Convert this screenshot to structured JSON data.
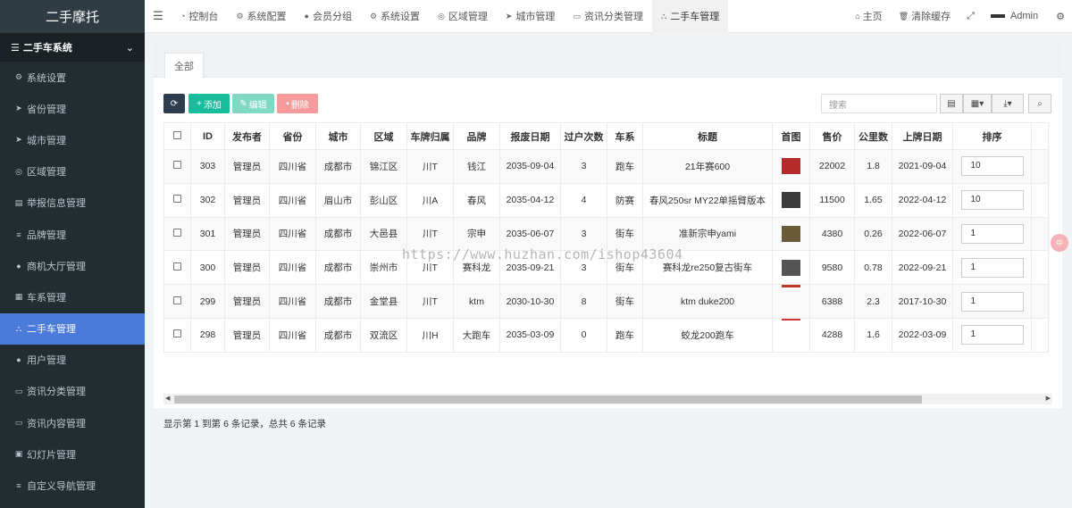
{
  "brand": "二手摩托",
  "sidebar": {
    "group_label": "二手车系统",
    "items": [
      {
        "label": "系统设置",
        "icon": "cogs-icon",
        "glyph": "⚙"
      },
      {
        "label": "省份管理",
        "icon": "location-arrow-icon",
        "glyph": "➤"
      },
      {
        "label": "城市管理",
        "icon": "location-arrow-icon",
        "glyph": "➤"
      },
      {
        "label": "区域管理",
        "icon": "compass-icon",
        "glyph": "◎"
      },
      {
        "label": "举报信息管理",
        "icon": "film-icon",
        "glyph": "▤"
      },
      {
        "label": "品牌管理",
        "icon": "list-icon",
        "glyph": "≡"
      },
      {
        "label": "商机大厅管理",
        "icon": "user-icon",
        "glyph": "●"
      },
      {
        "label": "车系管理",
        "icon": "server-icon",
        "glyph": "▦"
      },
      {
        "label": "二手车管理",
        "icon": "sitemap-icon",
        "glyph": "⛬"
      },
      {
        "label": "用户管理",
        "icon": "user-icon",
        "glyph": "●"
      },
      {
        "label": "资讯分类管理",
        "icon": "keyboard-icon",
        "glyph": "▭"
      },
      {
        "label": "资讯内容管理",
        "icon": "keyboard-icon",
        "glyph": "▭"
      },
      {
        "label": "幻灯片管理",
        "icon": "image-icon",
        "glyph": "▣"
      },
      {
        "label": "自定义导航管理",
        "icon": "list-icon",
        "glyph": "≡"
      }
    ]
  },
  "topbar": {
    "tabs": [
      {
        "label": "控制台",
        "icon": "dashboard-icon",
        "glyph": "◔"
      },
      {
        "label": "系统配置",
        "icon": "cog-icon",
        "glyph": "⚙"
      },
      {
        "label": "会员分组",
        "icon": "users-icon",
        "glyph": "●"
      },
      {
        "label": "系统设置",
        "icon": "cogs-icon",
        "glyph": "⚙"
      },
      {
        "label": "区域管理",
        "icon": "compass-icon",
        "glyph": "◎"
      },
      {
        "label": "城市管理",
        "icon": "location-arrow-icon",
        "glyph": "➤"
      },
      {
        "label": "资讯分类管理",
        "icon": "keyboard-icon",
        "glyph": "▭"
      },
      {
        "label": "二手车管理",
        "icon": "sitemap-icon",
        "glyph": "⛬"
      }
    ],
    "home": "主页",
    "clear_cache": "清除缓存",
    "user": "Admin"
  },
  "content": {
    "tab_all": "全部",
    "btn_add": "添加",
    "btn_edit": "编辑",
    "btn_delete": "删除",
    "search_placeholder": "搜索",
    "footer": "显示第 1 到第 6 条记录，总共 6 条记录"
  },
  "table": {
    "headers": [
      "ID",
      "发布者",
      "省份",
      "城市",
      "区域",
      "车牌归属",
      "品牌",
      "报废日期",
      "过户次数",
      "车系",
      "标题",
      "首图",
      "售价",
      "公里数",
      "上牌日期",
      "排序"
    ],
    "rows": [
      {
        "id": "303",
        "publisher": "管理员",
        "province": "四川省",
        "city": "成都市",
        "area": "锦江区",
        "plate": "川T",
        "brand": "钱江",
        "scrap": "2035-09-04",
        "transfers": "3",
        "series": "跑车",
        "title": "21年赛600",
        "thumb": "#b52a2a",
        "price": "22002",
        "km": "1.8",
        "reg": "2021-09-04",
        "sort": "10"
      },
      {
        "id": "302",
        "publisher": "管理员",
        "province": "四川省",
        "city": "眉山市",
        "area": "彭山区",
        "plate": "川A",
        "brand": "春风",
        "scrap": "2035-04-12",
        "transfers": "4",
        "series": "防赛",
        "title": "春风250sr MY22单摇臂版本",
        "thumb": "#3a3a3a",
        "price": "11500",
        "km": "1.65",
        "reg": "2022-04-12",
        "sort": "10"
      },
      {
        "id": "301",
        "publisher": "管理员",
        "province": "四川省",
        "city": "成都市",
        "area": "大邑县",
        "plate": "川T",
        "brand": "宗申",
        "scrap": "2035-06-07",
        "transfers": "3",
        "series": "街车",
        "title": "准新宗申yami",
        "thumb": "#6b5a3a",
        "price": "4380",
        "km": "0.26",
        "reg": "2022-06-07",
        "sort": "1"
      },
      {
        "id": "300",
        "publisher": "管理员",
        "province": "四川省",
        "city": "成都市",
        "area": "崇州市",
        "plate": "川T",
        "brand": "赛科龙",
        "scrap": "2035-09-21",
        "transfers": "3",
        "series": "街车",
        "title": "赛科龙re250复古街车",
        "thumb": "#555555",
        "price": "9580",
        "km": "0.78",
        "reg": "2022-09-21",
        "sort": "1"
      },
      {
        "id": "299",
        "publisher": "管理员",
        "province": "四川省",
        "city": "成都市",
        "area": "金堂县",
        "plate": "川T",
        "brand": "ktm",
        "scrap": "2030-10-30",
        "transfers": "8",
        "series": "街车",
        "title": "ktm duke200",
        "thumb": "#c0392b",
        "price": "6388",
        "km": "2.3",
        "reg": "2017-10-30",
        "sort": "1"
      },
      {
        "id": "298",
        "publisher": "管理员",
        "province": "四川省",
        "city": "成都市",
        "area": "双流区",
        "plate": "川H",
        "brand": "大跑车",
        "scrap": "2035-03-09",
        "transfers": "0",
        "series": "跑车",
        "title": "蛟龙200跑车",
        "thumb": "#d0393b",
        "price": "4288",
        "km": "1.6",
        "reg": "2022-03-09",
        "sort": "1"
      }
    ]
  },
  "watermark": "https://www.huzhan.com/ishop43604",
  "float_badge": "中"
}
